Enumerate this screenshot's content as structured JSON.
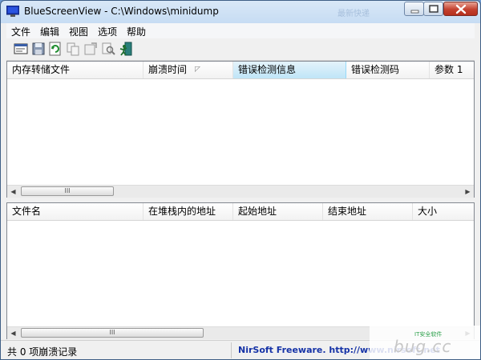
{
  "window": {
    "title": "BlueScreenView  -  C:\\Windows\\minidump",
    "watermark_title": "最新快递"
  },
  "menu": [
    "文件",
    "编辑",
    "视图",
    "选项",
    "帮助"
  ],
  "toolbar": {
    "icons": [
      "properties-icon",
      "save-icon",
      "refresh-icon",
      "copy-icon",
      "open-icon",
      "find-icon",
      "exit-icon"
    ]
  },
  "top_pane": {
    "columns": [
      "内存转储文件",
      "崩溃时间",
      "错误检测信息",
      "错误检测码",
      "参数 1"
    ],
    "sorted_column": "崩溃时间",
    "selected_column": "错误检测信息",
    "rows": [],
    "scroll_grip": "III"
  },
  "bottom_pane": {
    "columns": [
      "文件名",
      "在堆栈内的地址",
      "起始地址",
      "结束地址",
      "大小"
    ],
    "rows": [],
    "scroll_grip": "III"
  },
  "status": {
    "count_text": "共 0 项崩溃记录",
    "link_text": "NirSoft Freeware.  http://www.nirsoft.net"
  },
  "overlay_watermark": {
    "text": "bug.cc",
    "small_text": "IT安全软件"
  }
}
